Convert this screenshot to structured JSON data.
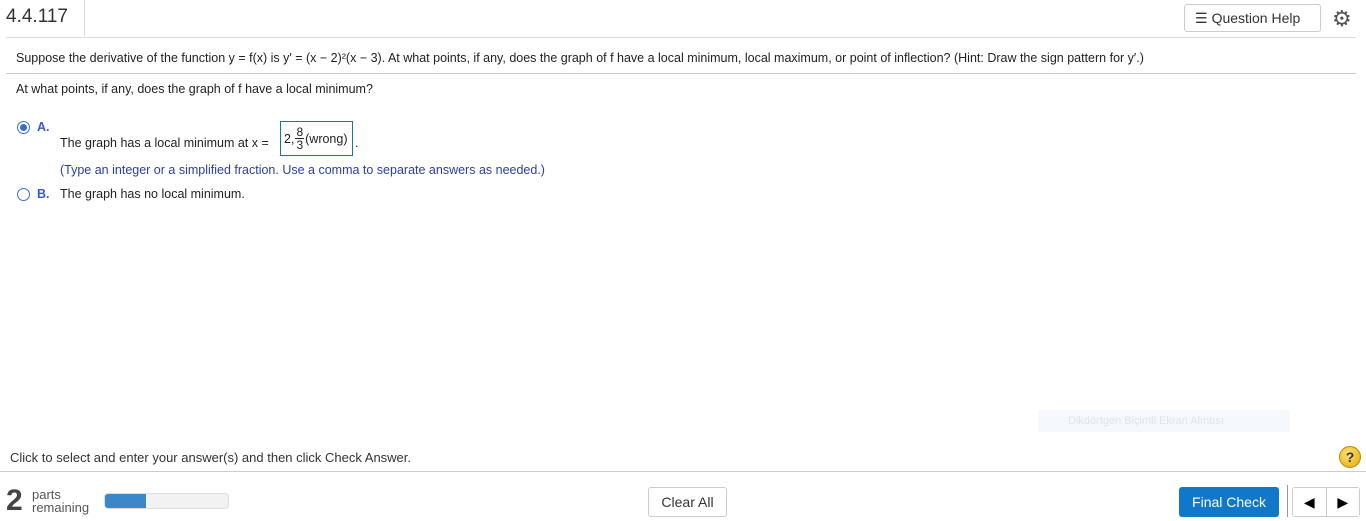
{
  "header": {
    "title": "4.4.117",
    "question_help": "Question Help",
    "icons": [
      "list-icon",
      "gear-icon"
    ]
  },
  "question": "Suppose the derivative of the function y = f(x) is y′ = (x − 2)²(x − 3). At what points, if any, does the graph of f have a local minimum, local maximum, or point of inflection? (Hint: Draw the sign pattern for y′.)",
  "prompt": "At what points, if any, does the graph of f have a local minimum?",
  "options": [
    {
      "label": "A.",
      "text": "The graph has a local minimum at x =",
      "selected": true,
      "answer": {
        "prefix": "2,",
        "num": "8",
        "den": "3",
        "suffix": "(wrong)"
      },
      "after": ".",
      "hint": "(Type an integer or a simplified fraction. Use a comma to separate answers as needed.)"
    },
    {
      "label": "B.",
      "text": "The graph has no local minimum.",
      "selected": false
    }
  ],
  "watermark": "Dikdörtgen Biçimli Ekran Alıntısı",
  "instruction": "Click to select and enter your answer(s) and then click Check Answer.",
  "footer": {
    "parts_count": "2",
    "parts_line1": "parts",
    "parts_line2": "remaining",
    "progress_percent": 33,
    "clear_all": "Clear All",
    "final_check": "Final Check",
    "prev": "◀",
    "next": "▶",
    "help": "?"
  },
  "colors": {
    "accent": "#1077c9",
    "progress": "#3c87c9",
    "option_label": "#3a5bbf"
  }
}
